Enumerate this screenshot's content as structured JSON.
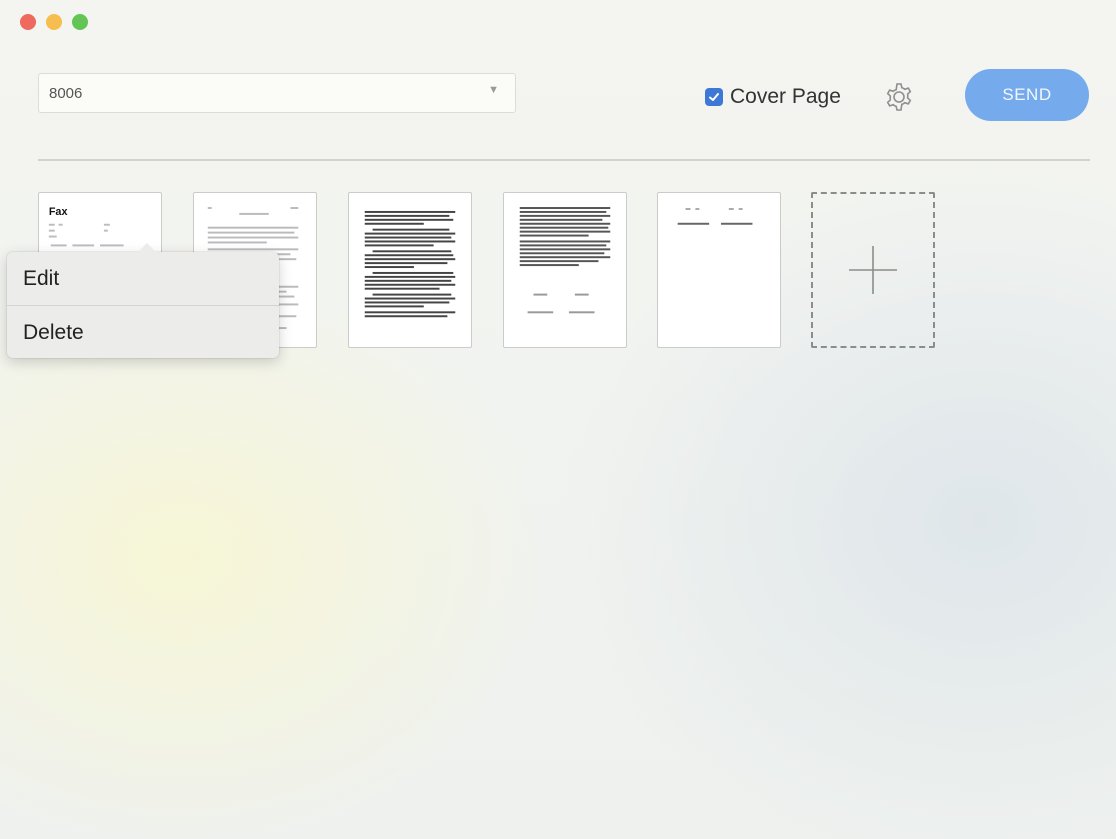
{
  "window": {
    "traffic_lights": [
      "close",
      "minimize",
      "maximize"
    ]
  },
  "toolbar": {
    "fax_number": "8006",
    "cover_page_label": "Cover Page",
    "cover_page_checked": true,
    "send_label": "SEND",
    "settings_icon": "gear-icon",
    "colors": {
      "accent": "#3e78d6",
      "send_button": "#75abed"
    }
  },
  "pages": [
    {
      "type": "cover-page",
      "title": "Fax"
    },
    {
      "type": "document-page"
    },
    {
      "type": "document-page"
    },
    {
      "type": "document-page"
    },
    {
      "type": "document-page"
    }
  ],
  "add_page": {
    "icon": "plus-icon"
  },
  "context_menu": {
    "items": [
      {
        "label": "Edit"
      },
      {
        "label": "Delete"
      }
    ]
  }
}
